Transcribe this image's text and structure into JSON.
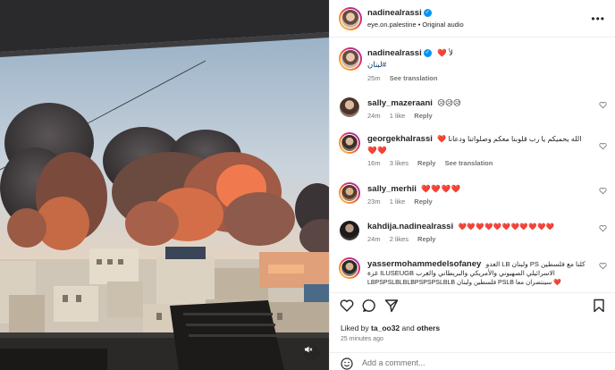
{
  "post": {
    "author": "nadinealrassi",
    "subtitle": "eye.on.palestine • Original audio",
    "caption_line1": "لأ ❤️",
    "caption_line2": "#لبنان",
    "caption_age": "25m",
    "see_translation": "See translation"
  },
  "comments": [
    {
      "user": "sally_mazeraani",
      "text": "😥😥😥",
      "age": "24m",
      "likes": "1 like",
      "reply": "Reply",
      "translate": ""
    },
    {
      "user": "georgekhalrassi",
      "text": "الله يحميكم يا رب قلوبنا معكم وصلواتنا ودعانا ❤️",
      "text2": "❤️❤️",
      "age": "16m",
      "likes": "3 likes",
      "reply": "Reply",
      "translate": "See translation"
    },
    {
      "user": "sally_merhii",
      "text": "❤️❤️❤️❤️",
      "age": "23m",
      "likes": "1 like",
      "reply": "Reply",
      "translate": ""
    },
    {
      "user": "kahdija.nadinealrassi",
      "text": "❤️❤️❤️❤️❤️❤️❤️❤️❤️❤️❤️",
      "age": "24m",
      "likes": "2 likes",
      "reply": "Reply",
      "translate": ""
    },
    {
      "user": "yassermohammedelsofaney",
      "text": "كلنا مع فلسطين PS ولبنان LB العدو",
      "text2": "الاسرائيلي الصهيوني والأمريكي والبريطاني والغرب ILUSEUGB غزة",
      "text3": "LBPSPSLBLBLBPSPSPSLBLB فلسطين ولبنان PSLB سينتصران معا ❤️"
    }
  ],
  "footer": {
    "liked_by_prefix": "Liked by ",
    "liked_by_user": "ta_oo32",
    "liked_by_and": " and ",
    "liked_by_others": "others",
    "timestamp": "25 minutes ago",
    "add_comment_placeholder": "Add a comment..."
  },
  "colors": {
    "heart": "#e0245e",
    "verified": "#0095f6",
    "meta": "#737373",
    "text": "#262626"
  },
  "icons": [
    "more-icon",
    "heart-icon",
    "comment-icon",
    "share-icon",
    "bookmark-icon",
    "emoji-icon",
    "mute-icon"
  ]
}
